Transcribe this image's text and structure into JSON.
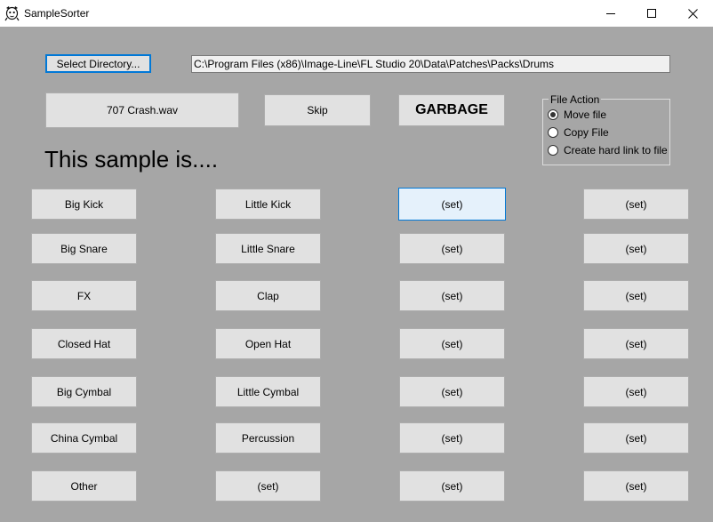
{
  "window": {
    "title": "SampleSorter",
    "controls": [
      "minimize-icon",
      "maximize-icon",
      "close-icon"
    ]
  },
  "toolbar": {
    "select_directory_label": "Select Directory...",
    "path_value": "C:\\Program Files (x86)\\Image-Line\\FL Studio 20\\Data\\Patches\\Packs\\Drums"
  },
  "sample": {
    "current_file": "707 Crash.wav",
    "skip_label": "Skip",
    "garbage_label": "GARBAGE",
    "heading": "This sample is...."
  },
  "file_action": {
    "legend": "File Action",
    "options": [
      "Move file",
      "Copy File",
      "Create hard link to file"
    ],
    "selected": "Move file"
  },
  "categories": {
    "col1": [
      "Big Kick",
      "Big Snare",
      "FX",
      "Closed Hat",
      "Big Cymbal",
      "China Cymbal",
      "Other"
    ],
    "col2": [
      "Little Kick",
      "Little Snare",
      "Clap",
      "Open Hat",
      "Little Cymbal",
      "Percussion",
      "(set)"
    ],
    "col3": [
      "(set)",
      "(set)",
      "(set)",
      "(set)",
      "(set)",
      "(set)",
      "(set)"
    ],
    "col4": [
      "(set)",
      "(set)",
      "(set)",
      "(set)",
      "(set)",
      "(set)",
      "(set)"
    ]
  },
  "colors": {
    "client_bg": "#a6a6a6",
    "button_bg": "#e1e1e1",
    "focus_accent": "#0078d7"
  }
}
